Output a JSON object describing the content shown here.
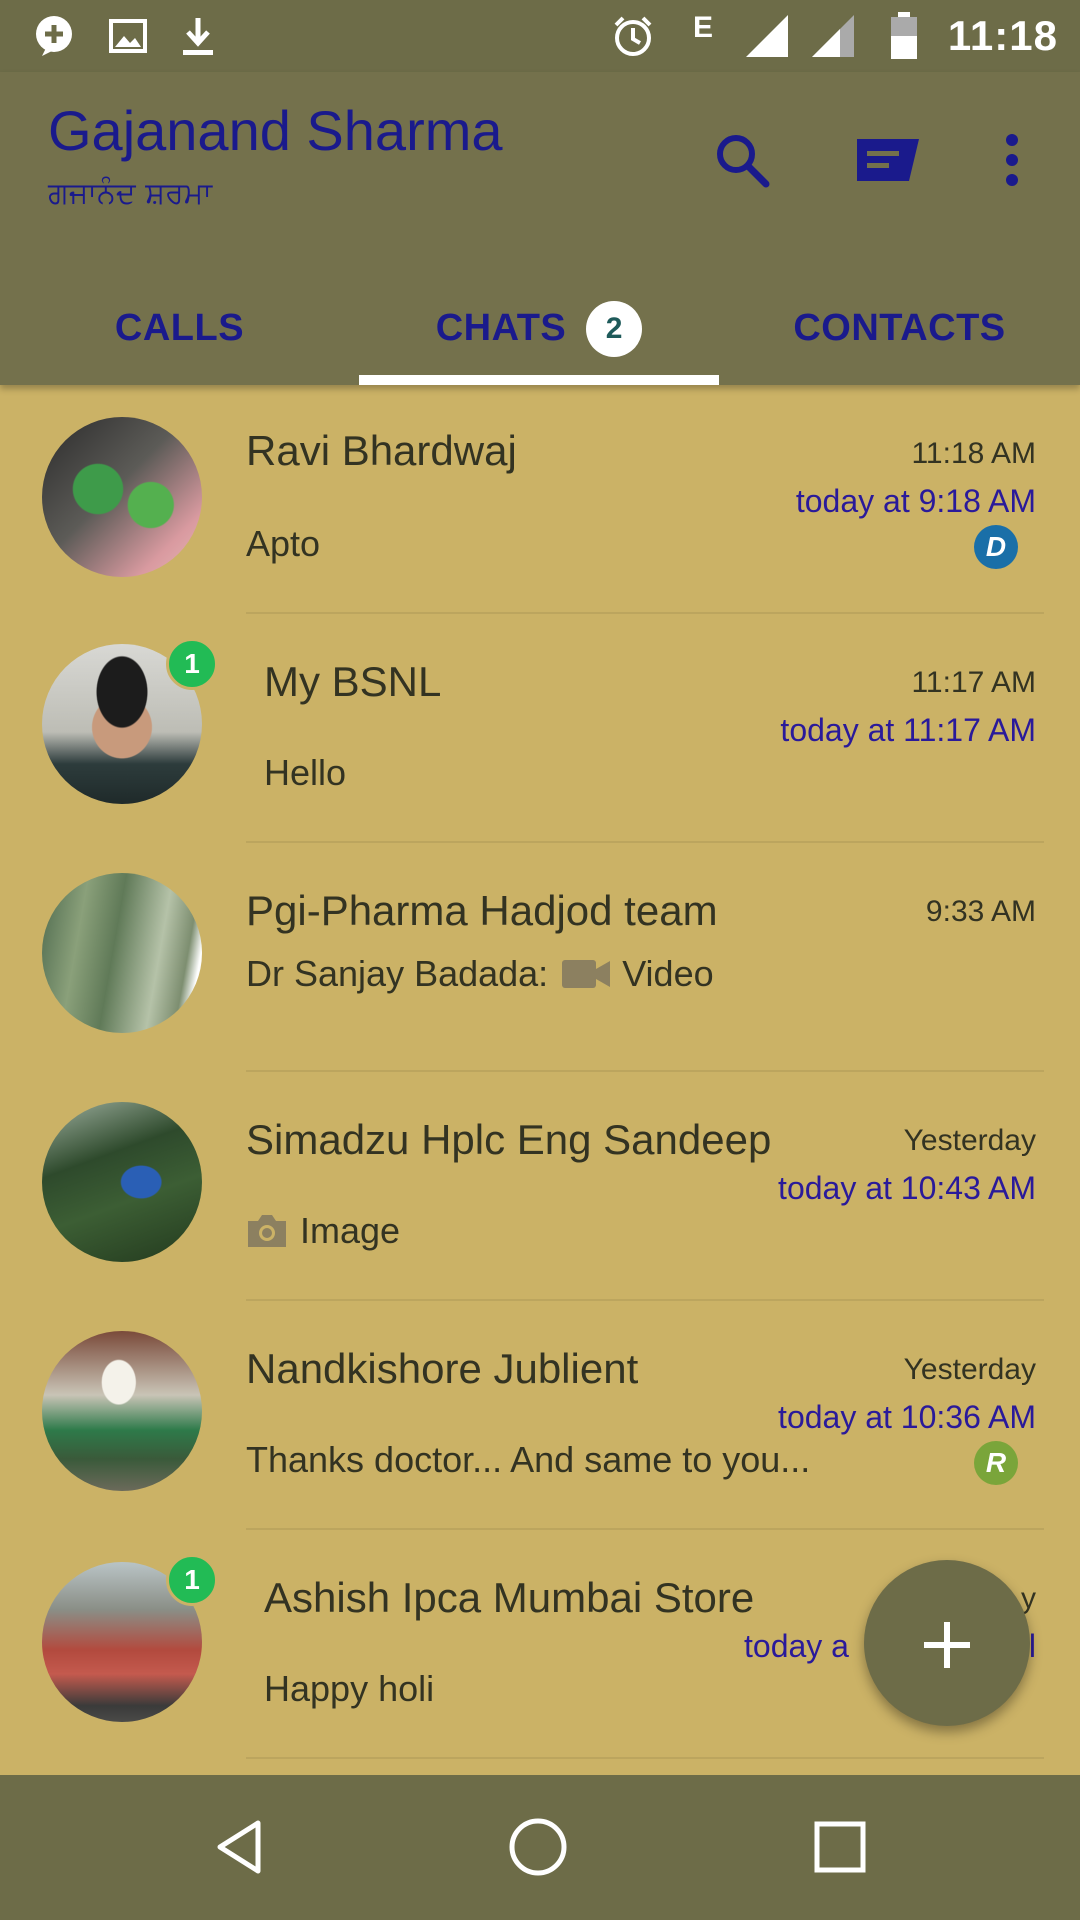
{
  "status_bar": {
    "time": "11:18",
    "network": "E",
    "icons": [
      "message-plus-icon",
      "image-icon",
      "download-icon",
      "alarm-icon",
      "signal-icon",
      "signal-icon",
      "battery-icon"
    ]
  },
  "header": {
    "title": "Gajanand Sharma",
    "subtitle": "ਗਜਾਨੰਦ ਸ਼ਰਮਾ",
    "actions": [
      "search-icon",
      "new-message-icon",
      "more-vert-icon"
    ]
  },
  "tabs": [
    {
      "label": "CALLS"
    },
    {
      "label": "CHATS",
      "badge": "2",
      "selected": true
    },
    {
      "label": "CONTACTS"
    }
  ],
  "chats": [
    {
      "name": "Ravi Bhardwaj",
      "time": "11:18 AM",
      "status": "today at 9:18 AM",
      "message": "Apto",
      "badge_letter": "D",
      "badge_color": "#1a6fa8",
      "unread": ""
    },
    {
      "name": "My BSNL",
      "time": "11:17 AM",
      "status": "today at 11:17 AM",
      "message": "Hello",
      "badge_letter": "",
      "unread": "1"
    },
    {
      "name": "Pgi-Pharma Hadjod team",
      "time": "9:33 AM",
      "status": "",
      "message_prefix": "Dr Sanjay Badada:",
      "message": "Video",
      "message_icon": "video-icon",
      "unread": ""
    },
    {
      "name": "Simadzu Hplc Eng Sandeep",
      "time": "Yesterday",
      "status": "today at 10:43 AM",
      "message": "Image",
      "message_icon": "camera-icon",
      "unread": ""
    },
    {
      "name": "Nandkishore Jublient",
      "time": "Yesterday",
      "status": "today at 10:36 AM",
      "message": "Thanks doctor... And same to you...",
      "badge_letter": "R",
      "badge_color": "#7aa53a",
      "unread": ""
    },
    {
      "name": "Ashish Ipca Mumbai Store",
      "time": "y",
      "status": "today a",
      "status_tail": "l",
      "message": "Happy holi",
      "unread": "1"
    }
  ],
  "fab": {
    "icon": "plus-icon",
    "label": "+"
  },
  "nav": [
    "back-icon",
    "home-icon",
    "recents-icon"
  ],
  "colors": {
    "status_bar": "#6d6c48",
    "app_bar": "#74714c",
    "list_bg": "#cbb266",
    "accent_text": "#1a1a8c",
    "unread_badge": "#22bb55"
  }
}
